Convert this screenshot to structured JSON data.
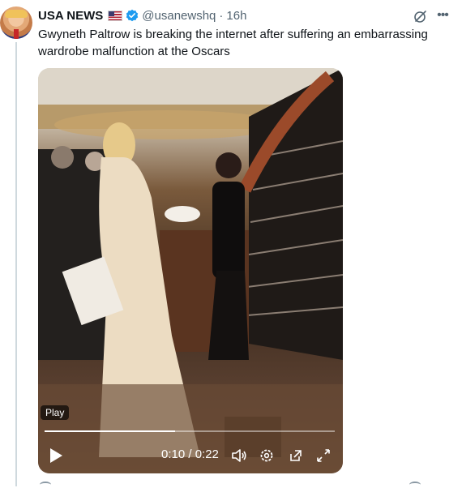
{
  "post": {
    "author": {
      "display_name": "USA NEWS",
      "handle": "@usanewshq",
      "separator": "·",
      "time": "16h",
      "flag_icon": "us-flag-icon",
      "verified_icon": "verified-badge-icon"
    },
    "text": "Gwyneth Paltrow is breaking the internet after suffering an embarrassing wardrobe malfunction at the Oscars",
    "actions": {
      "grok_icon": "grok-icon",
      "more_icon": "more-icon"
    }
  },
  "video": {
    "badge": "Play",
    "current_time": "0:10",
    "duration": "0:22",
    "time_display": "0:10 / 0:22",
    "progress_fraction": 0.45,
    "controls": [
      "play-icon",
      "volume-icon",
      "settings-icon",
      "popout-icon",
      "fullscreen-icon"
    ]
  },
  "colors": {
    "accent_blue": "#1d9bf0",
    "muted_text": "#536471",
    "primary_text": "#0f1419"
  }
}
